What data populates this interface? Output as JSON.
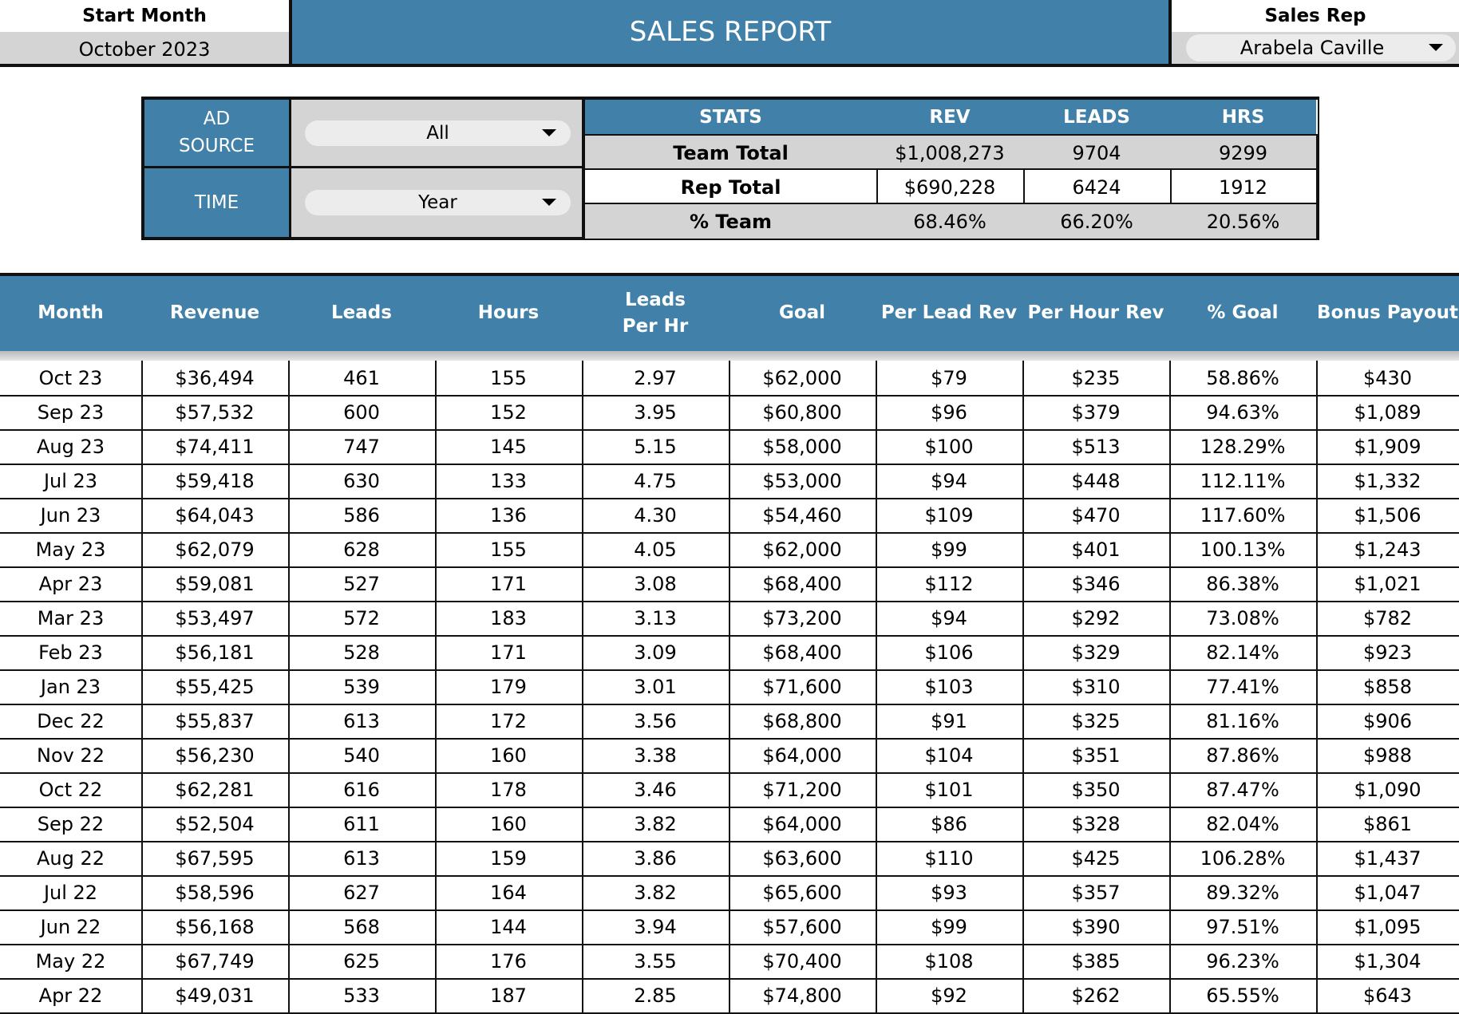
{
  "header": {
    "start_month_label": "Start Month",
    "start_month_value": "October 2023",
    "title": "SALES REPORT",
    "sales_rep_label": "Sales Rep",
    "sales_rep_value": "Arabela Caville"
  },
  "filters": {
    "ad_source_label": "AD\nSOURCE",
    "ad_source_value": "All",
    "time_label": "TIME",
    "time_value": "Year"
  },
  "stats": {
    "headers": [
      "STATS",
      "REV",
      "LEADS",
      "HRS"
    ],
    "rows": [
      [
        "Team Total",
        "$1,008,273",
        "9704",
        "9299"
      ],
      [
        "Rep Total",
        "$690,228",
        "6424",
        "1912"
      ],
      [
        "% Team",
        "68.46%",
        "66.20%",
        "20.56%"
      ]
    ]
  },
  "table": {
    "columns": [
      "Month",
      "Revenue",
      "Leads",
      "Hours",
      "Leads\nPer Hr",
      "Goal",
      "Per Lead Rev",
      "Per Hour Rev",
      "% Goal",
      "Bonus Payout"
    ],
    "rows": [
      [
        "Oct 23",
        "$36,494",
        "461",
        "155",
        "2.97",
        "$62,000",
        "$79",
        "$235",
        "58.86%",
        "$430"
      ],
      [
        "Sep 23",
        "$57,532",
        "600",
        "152",
        "3.95",
        "$60,800",
        "$96",
        "$379",
        "94.63%",
        "$1,089"
      ],
      [
        "Aug 23",
        "$74,411",
        "747",
        "145",
        "5.15",
        "$58,000",
        "$100",
        "$513",
        "128.29%",
        "$1,909"
      ],
      [
        "Jul 23",
        "$59,418",
        "630",
        "133",
        "4.75",
        "$53,000",
        "$94",
        "$448",
        "112.11%",
        "$1,332"
      ],
      [
        "Jun 23",
        "$64,043",
        "586",
        "136",
        "4.30",
        "$54,460",
        "$109",
        "$470",
        "117.60%",
        "$1,506"
      ],
      [
        "May 23",
        "$62,079",
        "628",
        "155",
        "4.05",
        "$62,000",
        "$99",
        "$401",
        "100.13%",
        "$1,243"
      ],
      [
        "Apr 23",
        "$59,081",
        "527",
        "171",
        "3.08",
        "$68,400",
        "$112",
        "$346",
        "86.38%",
        "$1,021"
      ],
      [
        "Mar 23",
        "$53,497",
        "572",
        "183",
        "3.13",
        "$73,200",
        "$94",
        "$292",
        "73.08%",
        "$782"
      ],
      [
        "Feb 23",
        "$56,181",
        "528",
        "171",
        "3.09",
        "$68,400",
        "$106",
        "$329",
        "82.14%",
        "$923"
      ],
      [
        "Jan 23",
        "$55,425",
        "539",
        "179",
        "3.01",
        "$71,600",
        "$103",
        "$310",
        "77.41%",
        "$858"
      ],
      [
        "Dec 22",
        "$55,837",
        "613",
        "172",
        "3.56",
        "$68,800",
        "$91",
        "$325",
        "81.16%",
        "$906"
      ],
      [
        "Nov 22",
        "$56,230",
        "540",
        "160",
        "3.38",
        "$64,000",
        "$104",
        "$351",
        "87.86%",
        "$988"
      ],
      [
        "Oct 22",
        "$62,281",
        "616",
        "178",
        "3.46",
        "$71,200",
        "$101",
        "$350",
        "87.47%",
        "$1,090"
      ],
      [
        "Sep 22",
        "$52,504",
        "611",
        "160",
        "3.82",
        "$64,000",
        "$86",
        "$328",
        "82.04%",
        "$861"
      ],
      [
        "Aug 22",
        "$67,595",
        "613",
        "159",
        "3.86",
        "$63,600",
        "$110",
        "$425",
        "106.28%",
        "$1,437"
      ],
      [
        "Jul 22",
        "$58,596",
        "627",
        "164",
        "3.82",
        "$65,600",
        "$93",
        "$357",
        "89.32%",
        "$1,047"
      ],
      [
        "Jun 22",
        "$56,168",
        "568",
        "144",
        "3.94",
        "$57,600",
        "$99",
        "$390",
        "97.51%",
        "$1,095"
      ],
      [
        "May 22",
        "$67,749",
        "625",
        "176",
        "3.55",
        "$70,400",
        "$108",
        "$385",
        "96.23%",
        "$1,304"
      ],
      [
        "Apr 22",
        "$49,031",
        "533",
        "187",
        "2.85",
        "$74,800",
        "$92",
        "$262",
        "65.55%",
        "$643"
      ]
    ]
  },
  "colors": {
    "header_blue": "#4180a8",
    "label_grey": "#d4d4d4",
    "dropdown_fill": "#ececec",
    "border": "#111111"
  },
  "icons": {
    "dropdown": "caret-down-icon"
  }
}
